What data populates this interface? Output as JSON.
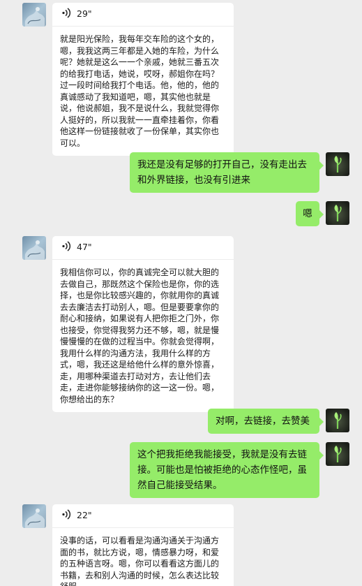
{
  "messages": [
    {
      "id": "m1",
      "direction": "in",
      "voice_duration": "29\"",
      "transcript": "就是阳光保险，我每年交车险的这个女的，嗯，我我这两三年都是入她的车险，为什么呢？她就是这么一一个亲戚，她就三番五次的给我打电话，她说，哎呀，郝姐你在吗？过一段时间给我打个电话。他，他的，他的真诚感动了我知道吧，嗯，其实他也就是说，他说郝姐，我不是说什么，我就觉得你人挺好的，所以我就一一直牵挂着你，你看他这样一份链接就收了一份保单，其实你也可以。"
    },
    {
      "id": "m2",
      "direction": "out",
      "text": "我还是没有足够的打开自己，没有走出去和外界链接，也没有引进来"
    },
    {
      "id": "m3",
      "direction": "out",
      "text": "嗯"
    },
    {
      "id": "m4",
      "direction": "in",
      "voice_duration": "47\"",
      "transcript": "我相信你可以，你的真诚完全可以就大胆的去做自己，那既然这个保险也是你，你的选择，也是你比较感兴趣的，你就用你的真诚去去廉洁去打动别人，嗯。但是要要拿你的耐心和接纳，如果说有人把你拒之门外，你也接受，你觉得我努力还不够，嗯，就是慢慢慢慢的在做的过程当中。你就会觉得啊，我用什么样的沟通方法，我用什么样的方式，嗯，我还这是给他什么样的意外惊喜，走，用哪种渠道去打动对方，去让他们去走，走进你能够接纳你的这一这一份。嗯，你想给出的东？"
    },
    {
      "id": "m5",
      "direction": "out",
      "text": "对啊，去链接，去赞美"
    },
    {
      "id": "m6",
      "direction": "out",
      "text": "这个把我拒绝我能接受，我就是没有去链接。可能也是怕被拒绝的心态作怪吧，虽然自己能接受结果。"
    },
    {
      "id": "m7",
      "direction": "in",
      "voice_duration": "22\"",
      "transcript": "没事的话，可以看看是沟通沟通关于沟通方面的书，就比方说，嗯，情感暴力呀，和爱的五种语言呀。嗯，你可以看看这方面儿的书籍，去和别人沟通的时候，怎么表达比较舒服。"
    }
  ],
  "colors": {
    "background": "#ededed",
    "incoming_bubble": "#ffffff",
    "outgoing_bubble": "#95ec69"
  },
  "icons": {
    "voice": "voice-wave-icon",
    "contact_avatar": "contact-avatar",
    "self_avatar": "self-avatar-sprout"
  }
}
